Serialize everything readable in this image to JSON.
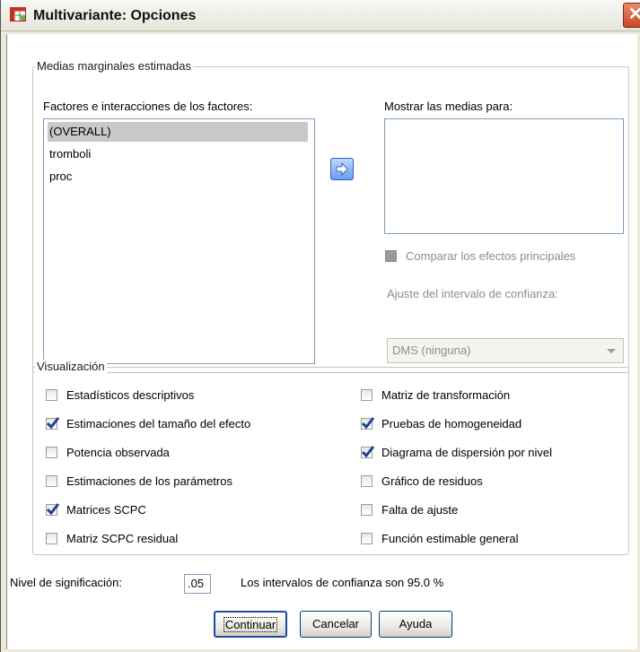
{
  "window": {
    "title": "Multivariante: Opciones",
    "close_glyph": "✕"
  },
  "marginal_means": {
    "group_label": "Medias marginales estimadas",
    "factors_label": "Factores e interacciones de los factores:",
    "factors": [
      "(OVERALL)",
      "tromboli",
      "proc"
    ],
    "selected_factor": "(OVERALL)",
    "display_means_label": "Mostrar las medias para:",
    "compare_main_effects_label": "Comparar los efectos principales",
    "ci_adjust_label": "Ajuste del intervalo de confianza:",
    "ci_adjust_value": "DMS (ninguna)",
    "move_icon": "right-arrow-icon"
  },
  "display": {
    "group_label": "Visualización",
    "left": [
      {
        "label": "Estadísticos descriptivos",
        "checked": false
      },
      {
        "label": "Estimaciones del tamaño del efecto",
        "checked": true
      },
      {
        "label": "Potencia observada",
        "checked": false
      },
      {
        "label": "Estimaciones de los parámetros",
        "checked": false
      },
      {
        "label": "Matrices SCPC",
        "checked": true
      },
      {
        "label": "Matriz SCPC residual",
        "checked": false
      }
    ],
    "right": [
      {
        "label": "Matriz de transformación",
        "checked": false
      },
      {
        "label": "Pruebas de homogeneidad",
        "checked": true
      },
      {
        "label": "Diagrama de dispersión por nivel",
        "checked": true
      },
      {
        "label": "Gráfico de residuos",
        "checked": false
      },
      {
        "label": "Falta de ajuste",
        "checked": false
      },
      {
        "label": "Función estimable general",
        "checked": false
      }
    ]
  },
  "significance": {
    "label": "Nivel de significación:",
    "value": ".05",
    "ci_text": "Los intervalos de confianza son 95.0 %"
  },
  "buttons": {
    "continue": "Continuar",
    "cancel": "Cancelar",
    "help": "Ayuda"
  },
  "colors": {
    "check": "#1f3f9a",
    "accent": "#2b62c5"
  }
}
